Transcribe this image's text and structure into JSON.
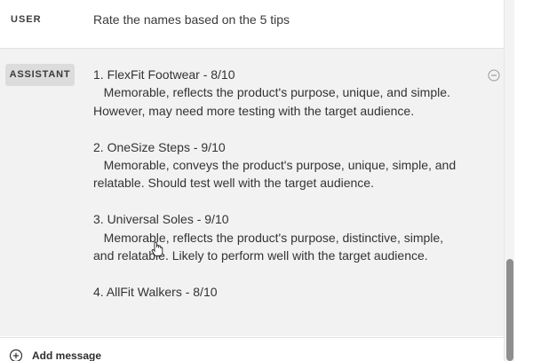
{
  "user_message": {
    "role": "USER",
    "text": "Rate the names based on the 5 tips"
  },
  "assistant_message": {
    "role": "ASSISTANT",
    "text": "1. FlexFit Footwear - 8/10\n   Memorable, reflects the product's purpose, unique, and simple.\nHowever, may need more testing with the target audience.\n\n2. OneSize Steps - 9/10\n   Memorable, conveys the product's purpose, unique, simple, and\nrelatable. Should test well with the target audience.\n\n3. Universal Soles - 9/10\n   Memorable, reflects the product's purpose, distinctive, simple,\nand relatable. Likely to perform well with the target audience.\n\n4. AllFit Walkers - 8/10",
    "remove_icon": "minus-circle-icon"
  },
  "composer": {
    "add_label": "Add message",
    "add_icon": "plus-circle-icon"
  },
  "colors": {
    "assistant_bg": "#f2f2f2",
    "role_badge_bg": "#dcdcdc",
    "scroll_thumb": "#8e8e8e"
  }
}
